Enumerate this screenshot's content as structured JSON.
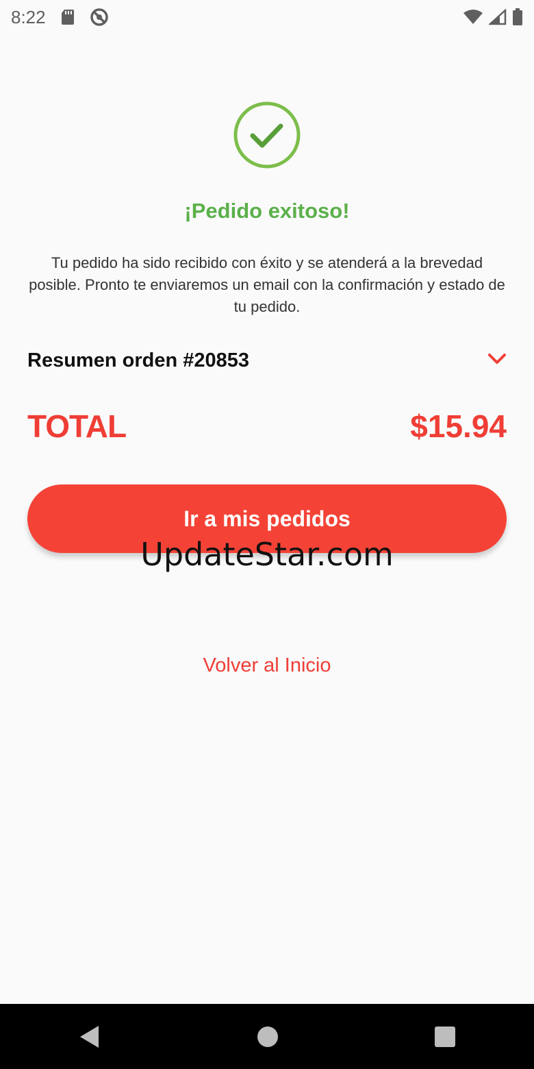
{
  "status_bar": {
    "time": "8:22",
    "icons_left": [
      "sd-card-icon",
      "do-not-disturb-icon"
    ],
    "icons_right": [
      "wifi-icon",
      "signal-icon",
      "battery-icon"
    ]
  },
  "success": {
    "icon": "check-circle-icon",
    "title": "¡Pedido exitoso!",
    "message": "Tu pedido ha sido recibido con éxito y se atenderá a la brevedad posible. Pronto te enviaremos un email con la confirmación y estado de tu pedido."
  },
  "summary": {
    "label": "Resumen orden #20853",
    "expand_icon": "chevron-down-icon"
  },
  "total": {
    "label": "TOTAL",
    "value": "$15.94"
  },
  "actions": {
    "primary_label": "Ir a mis pedidos",
    "secondary_label": "Volver al Inicio"
  },
  "watermark": "UpdateStar.com",
  "colors": {
    "accent": "#f44336",
    "success": "#5bb04a",
    "total_text": "#ef3e36"
  },
  "nav_bar": {
    "icons": [
      "back-icon",
      "home-icon",
      "recents-icon"
    ]
  }
}
